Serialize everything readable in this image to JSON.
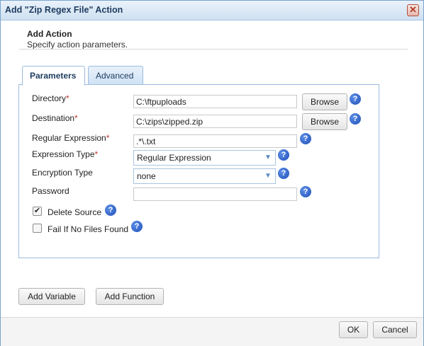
{
  "window": {
    "title": "Add \"Zip Regex File\" Action",
    "close_glyph": "✕"
  },
  "header": {
    "title": "Add Action",
    "subtitle": "Specify action parameters."
  },
  "tabs": [
    {
      "label": "Parameters",
      "active": true
    },
    {
      "label": "Advanced",
      "active": false
    }
  ],
  "fields": {
    "directory": {
      "label": "Directory",
      "required": "*",
      "value": "C:\\ftpuploads",
      "browse": "Browse"
    },
    "destination": {
      "label": "Destination",
      "required": "*",
      "value": "C:\\zips\\zipped.zip",
      "browse": "Browse"
    },
    "regex": {
      "label": "Regular Expression",
      "required": "*",
      "value": ".*\\.txt"
    },
    "expression_type": {
      "label": "Expression Type",
      "required": "*",
      "value": "Regular Expression"
    },
    "encryption_type": {
      "label": "Encryption Type",
      "value": "none"
    },
    "password": {
      "label": "Password",
      "value": ""
    }
  },
  "checkboxes": {
    "delete_source": {
      "label": "Delete Source",
      "checked": true,
      "glyph": "✔"
    },
    "fail_if_no_files": {
      "label": "Fail If No Files Found",
      "checked": false,
      "glyph": ""
    }
  },
  "help_glyph": "?",
  "chevron_glyph": "▼",
  "buttons": {
    "add_variable": "Add Variable",
    "add_function": "Add Function",
    "ok": "OK",
    "cancel": "Cancel"
  }
}
